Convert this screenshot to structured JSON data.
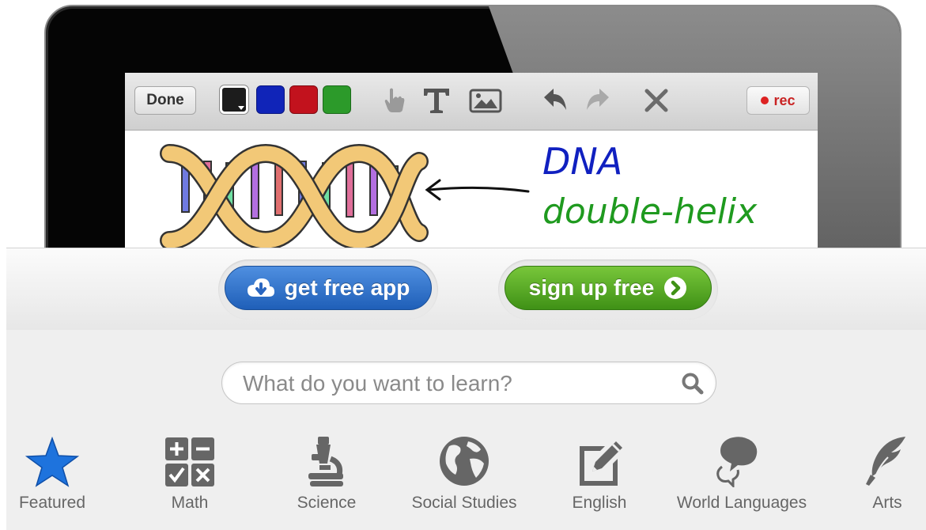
{
  "toolbar": {
    "done_label": "Done",
    "rec_label": "rec",
    "swatches": [
      "#1c1c1c",
      "#1024b8",
      "#c2121d",
      "#2c9a2a"
    ]
  },
  "canvas": {
    "line1": "DNA",
    "line2": "double-helix",
    "line1_color": "#1020c0",
    "line2_color": "#1f9a1f"
  },
  "actions": {
    "get_app_label": "get free app",
    "signup_label": "sign up free"
  },
  "search": {
    "placeholder": "What do you want to learn?"
  },
  "categories": [
    {
      "label": "Featured",
      "icon": "star-icon",
      "color": "#1e73dd"
    },
    {
      "label": "Math",
      "icon": "calculator-icon"
    },
    {
      "label": "Science",
      "icon": "microscope-icon"
    },
    {
      "label": "Social Studies",
      "icon": "globe-icon"
    },
    {
      "label": "English",
      "icon": "pencil-paper-icon"
    },
    {
      "label": "World Languages",
      "icon": "speech-bubbles-icon"
    },
    {
      "label": "Arts",
      "icon": "quill-icon"
    }
  ]
}
